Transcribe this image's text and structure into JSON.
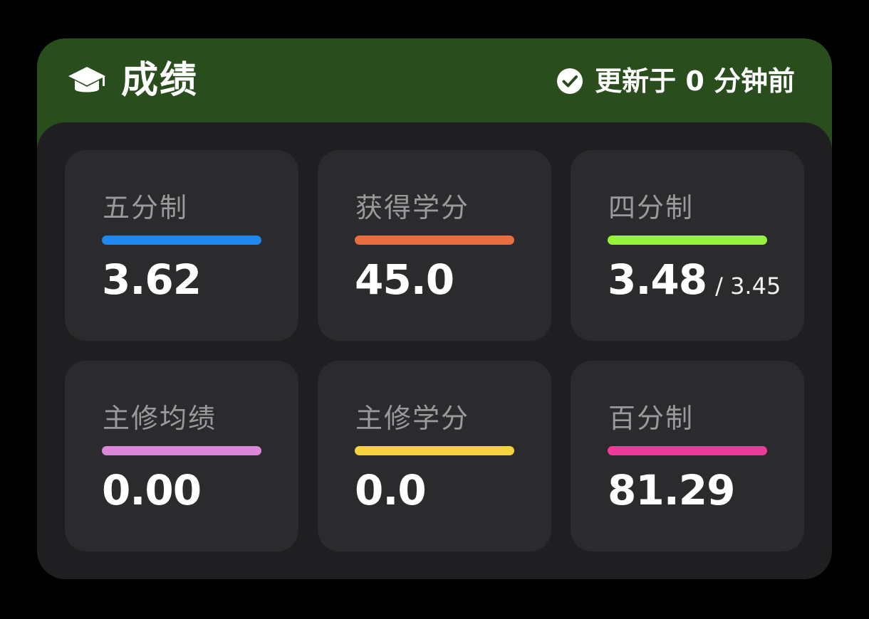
{
  "header": {
    "title": "成绩",
    "title_icon": "graduation-cap-icon",
    "status_icon": "check-circle-icon",
    "status_text": "更新于 0 分钟前",
    "background_color": "#2a4d1e"
  },
  "cards": [
    {
      "label": "五分制",
      "value": "3.62",
      "bar_color": "#1e88f0"
    },
    {
      "label": "获得学分",
      "value": "45.0",
      "bar_color": "#e86d40"
    },
    {
      "label": "四分制",
      "value": "3.48",
      "sub": "/ 3.45",
      "bar_color": "#97f23a"
    },
    {
      "label": "主修均绩",
      "value": "0.00",
      "bar_color": "#dc86dc"
    },
    {
      "label": "主修学分",
      "value": "0.0",
      "bar_color": "#f7d23a"
    },
    {
      "label": "百分制",
      "value": "81.29",
      "bar_color": "#ef3a9a"
    }
  ]
}
